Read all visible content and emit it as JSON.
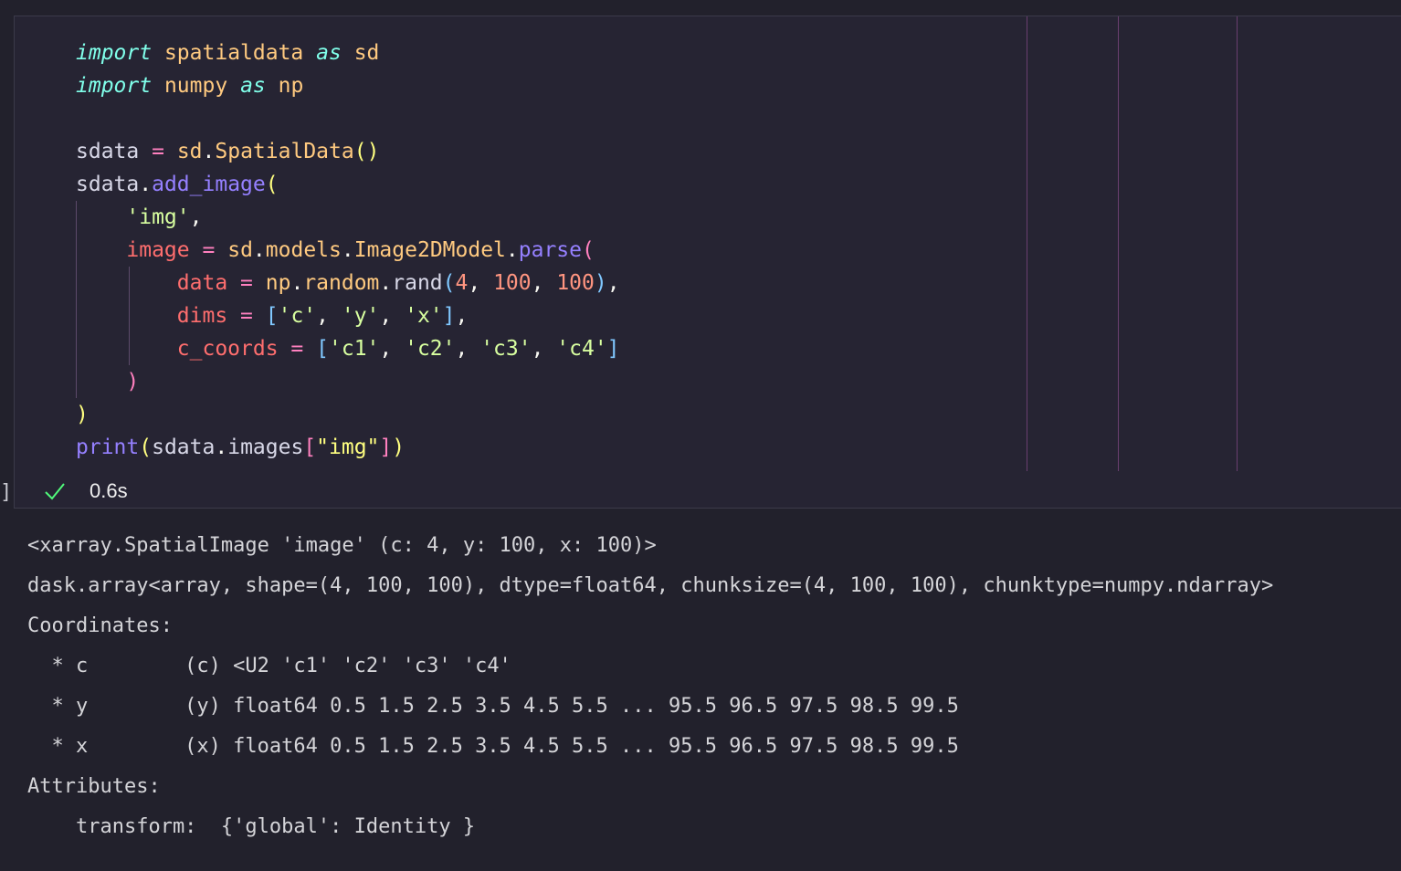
{
  "cell": {
    "code_lines": [
      [
        {
          "t": "import",
          "c": "kw"
        },
        {
          "t": " "
        },
        {
          "t": "spatialdata",
          "c": "mod"
        },
        {
          "t": " "
        },
        {
          "t": "as",
          "c": "kw"
        },
        {
          "t": " "
        },
        {
          "t": "sd",
          "c": "mod"
        }
      ],
      [
        {
          "t": "import",
          "c": "kw"
        },
        {
          "t": " "
        },
        {
          "t": "numpy",
          "c": "mod"
        },
        {
          "t": " "
        },
        {
          "t": "as",
          "c": "kw"
        },
        {
          "t": " "
        },
        {
          "t": "np",
          "c": "mod"
        }
      ],
      [],
      [
        {
          "t": "sdata",
          "c": "var"
        },
        {
          "t": " "
        },
        {
          "t": "=",
          "c": "op"
        },
        {
          "t": " "
        },
        {
          "t": "sd",
          "c": "mod"
        },
        {
          "t": ".",
          "c": "dot"
        },
        {
          "t": "SpatialData",
          "c": "cls"
        },
        {
          "t": "()",
          "c": "p1"
        }
      ],
      [
        {
          "t": "sdata",
          "c": "var"
        },
        {
          "t": ".",
          "c": "dot"
        },
        {
          "t": "add_image",
          "c": "meth"
        },
        {
          "t": "(",
          "c": "p1"
        }
      ],
      [
        {
          "t": "    "
        },
        {
          "t": "'img'",
          "c": "strd"
        },
        {
          "t": ",",
          "c": "dot"
        }
      ],
      [
        {
          "t": "    "
        },
        {
          "t": "image",
          "c": "param"
        },
        {
          "t": " "
        },
        {
          "t": "=",
          "c": "op"
        },
        {
          "t": " "
        },
        {
          "t": "sd",
          "c": "mod"
        },
        {
          "t": ".",
          "c": "dot"
        },
        {
          "t": "models",
          "c": "mod"
        },
        {
          "t": ".",
          "c": "dot"
        },
        {
          "t": "Image2DModel",
          "c": "cls"
        },
        {
          "t": ".",
          "c": "dot"
        },
        {
          "t": "parse",
          "c": "meth"
        },
        {
          "t": "(",
          "c": "p2"
        }
      ],
      [
        {
          "t": "        "
        },
        {
          "t": "data",
          "c": "param"
        },
        {
          "t": " "
        },
        {
          "t": "=",
          "c": "op"
        },
        {
          "t": " "
        },
        {
          "t": "np",
          "c": "mod"
        },
        {
          "t": ".",
          "c": "dot"
        },
        {
          "t": "random",
          "c": "mod"
        },
        {
          "t": ".",
          "c": "dot"
        },
        {
          "t": "rand",
          "c": "var"
        },
        {
          "t": "(",
          "c": "p3"
        },
        {
          "t": "4",
          "c": "num"
        },
        {
          "t": ", ",
          "c": "dot"
        },
        {
          "t": "100",
          "c": "num"
        },
        {
          "t": ", ",
          "c": "dot"
        },
        {
          "t": "100",
          "c": "num"
        },
        {
          "t": ")",
          "c": "p3"
        },
        {
          "t": ",",
          "c": "dot"
        }
      ],
      [
        {
          "t": "        "
        },
        {
          "t": "dims",
          "c": "param"
        },
        {
          "t": " "
        },
        {
          "t": "=",
          "c": "op"
        },
        {
          "t": " "
        },
        {
          "t": "[",
          "c": "p3"
        },
        {
          "t": "'c'",
          "c": "strd"
        },
        {
          "t": ", ",
          "c": "dot"
        },
        {
          "t": "'y'",
          "c": "strd"
        },
        {
          "t": ", ",
          "c": "dot"
        },
        {
          "t": "'x'",
          "c": "strd"
        },
        {
          "t": "]",
          "c": "p3"
        },
        {
          "t": ",",
          "c": "dot"
        }
      ],
      [
        {
          "t": "        "
        },
        {
          "t": "c_coords",
          "c": "param"
        },
        {
          "t": " "
        },
        {
          "t": "=",
          "c": "op"
        },
        {
          "t": " "
        },
        {
          "t": "[",
          "c": "p3"
        },
        {
          "t": "'c1'",
          "c": "strd"
        },
        {
          "t": ", ",
          "c": "dot"
        },
        {
          "t": "'c2'",
          "c": "strd"
        },
        {
          "t": ", ",
          "c": "dot"
        },
        {
          "t": "'c3'",
          "c": "strd"
        },
        {
          "t": ", ",
          "c": "dot"
        },
        {
          "t": "'c4'",
          "c": "strd"
        },
        {
          "t": "]",
          "c": "p3"
        }
      ],
      [
        {
          "t": "    "
        },
        {
          "t": ")",
          "c": "p2"
        }
      ],
      [
        {
          "t": ")",
          "c": "p1"
        }
      ],
      [
        {
          "t": "print",
          "c": "builtin"
        },
        {
          "t": "(",
          "c": "p1"
        },
        {
          "t": "sdata",
          "c": "var"
        },
        {
          "t": ".",
          "c": "dot"
        },
        {
          "t": "images",
          "c": "var"
        },
        {
          "t": "[",
          "c": "p2"
        },
        {
          "t": "\"img\"",
          "c": "str"
        },
        {
          "t": "]",
          "c": "p2"
        },
        {
          "t": ")",
          "c": "p1"
        }
      ]
    ],
    "gutter_marker": "]",
    "status_icon": "check-icon",
    "status_color": "#50fa7b",
    "exec_time": "0.6s"
  },
  "output": {
    "lines": [
      "<xarray.SpatialImage 'image' (c: 4, y: 100, x: 100)>",
      "dask.array<array, shape=(4, 100, 100), dtype=float64, chunksize=(4, 100, 100), chunktype=numpy.ndarray>",
      "Coordinates:",
      "  * c        (c) <U2 'c1' 'c2' 'c3' 'c4'",
      "  * y        (y) float64 0.5 1.5 2.5 3.5 4.5 5.5 ... 95.5 96.5 97.5 98.5 99.5",
      "  * x        (x) float64 0.5 1.5 2.5 3.5 4.5 5.5 ... 95.5 96.5 97.5 98.5 99.5",
      "Attributes:",
      "    transform:  {'global': Identity }"
    ]
  }
}
